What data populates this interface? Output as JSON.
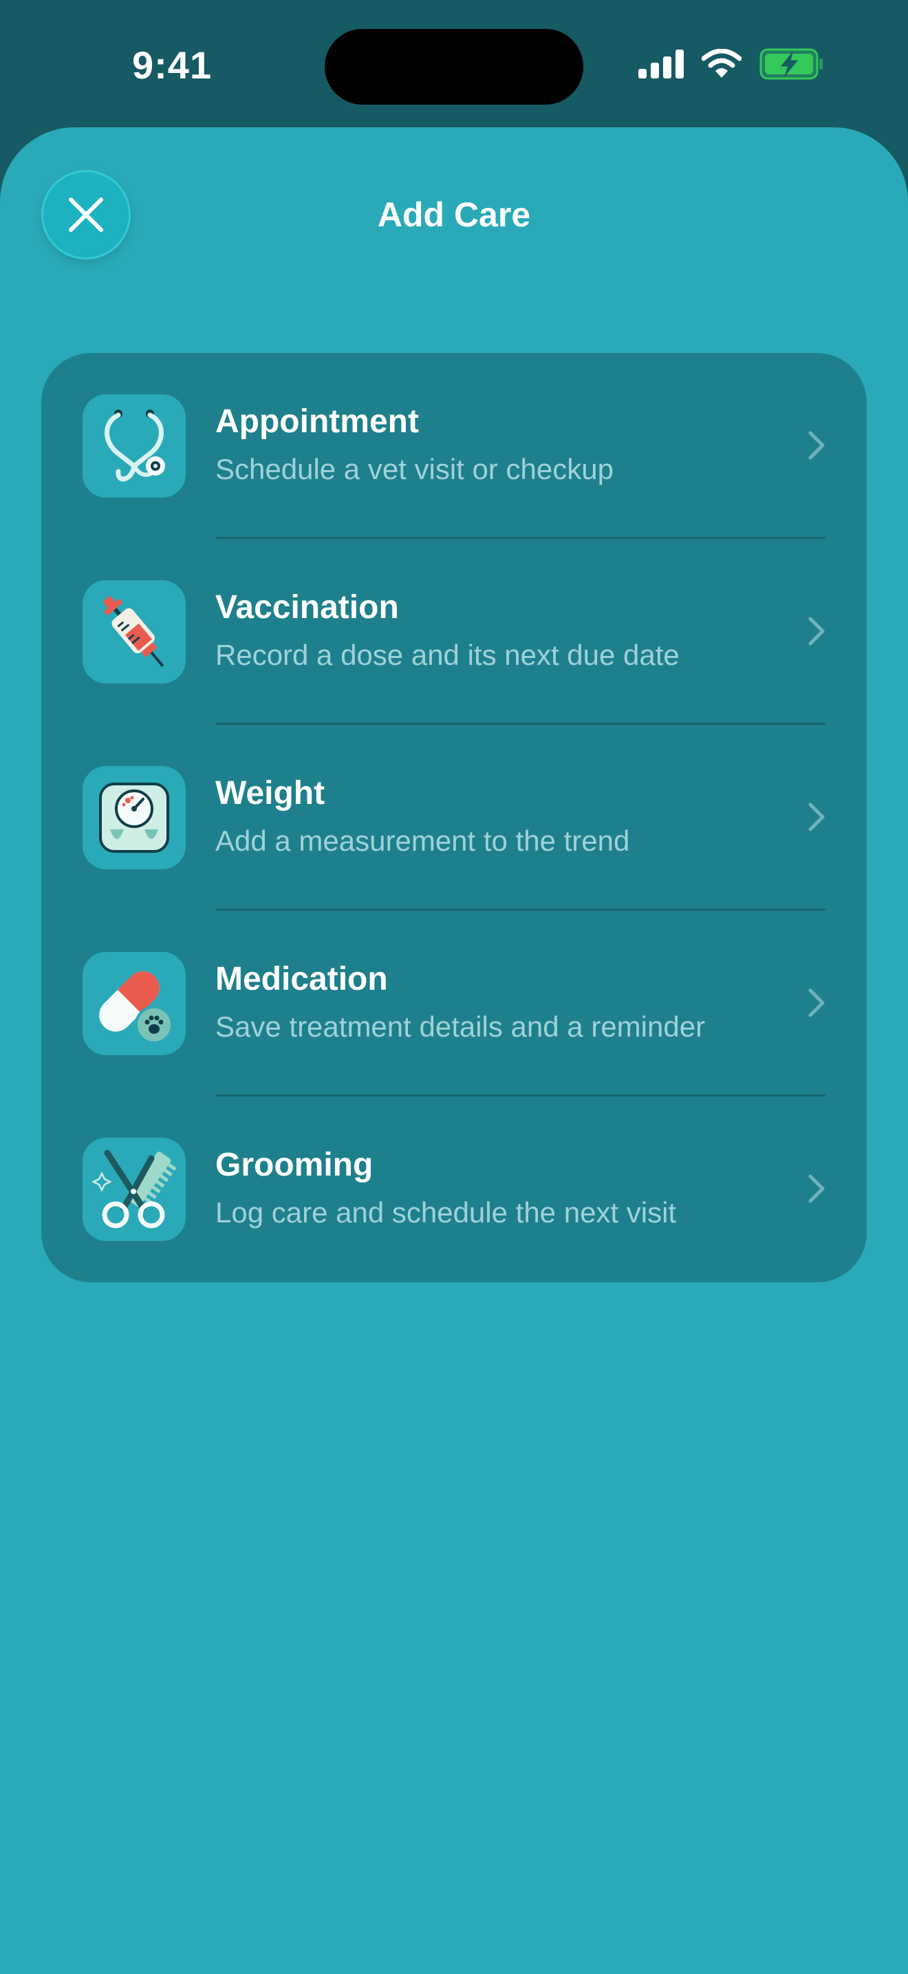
{
  "status_bar": {
    "time": "9:41",
    "icons": [
      "signal-icon",
      "wifi-icon",
      "battery-charging-icon"
    ]
  },
  "sheet": {
    "title": "Add Care",
    "close_icon": "close-icon"
  },
  "care_options": [
    {
      "title": "Appointment",
      "subtitle": "Schedule a vet visit or checkup",
      "icon": "stethoscope-icon"
    },
    {
      "title": "Vaccination",
      "subtitle": "Record a dose and its next due date",
      "icon": "syringe-icon"
    },
    {
      "title": "Weight",
      "subtitle": "Add a measurement to the trend",
      "icon": "scale-icon"
    },
    {
      "title": "Medication",
      "subtitle": "Save treatment details and a reminder",
      "icon": "pill-icon"
    },
    {
      "title": "Grooming",
      "subtitle": "Log care and schedule the next visit",
      "icon": "scissors-comb-icon"
    }
  ],
  "colors": {
    "background_top": "#165a63",
    "sheet": "#2aaab8",
    "card": "#1e808c",
    "subtitle_text": "#9fd2d8",
    "battery_green": "#34c759"
  }
}
